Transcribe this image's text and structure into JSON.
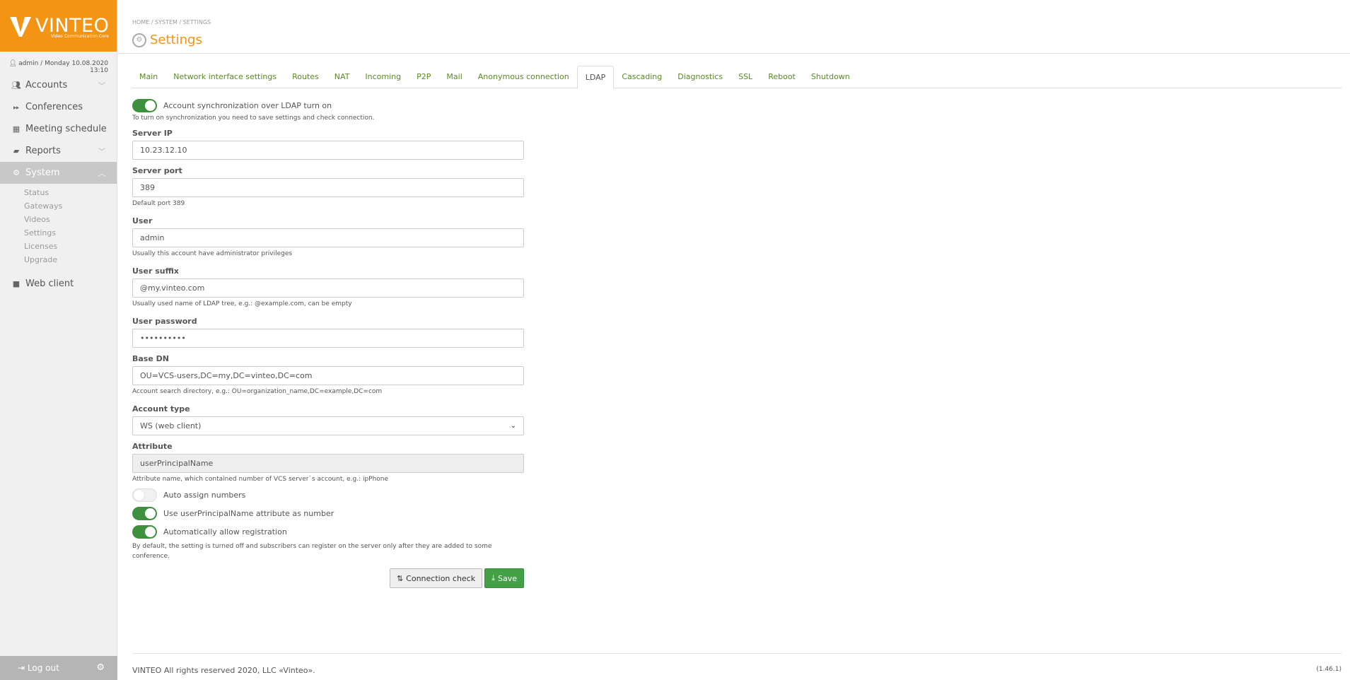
{
  "logo": {
    "title": "VINTEO",
    "subtitle": "Video Communication Core"
  },
  "user_line": "admin / Monday 10.08.2020 13:10",
  "nav": {
    "accounts": "Accounts",
    "conferences": "Conferences",
    "meeting_schedule": "Meeting schedule",
    "reports": "Reports",
    "system": "System",
    "system_sub": [
      "Status",
      "Gateways",
      "Videos",
      "Settings",
      "Licenses",
      "Upgrade"
    ],
    "web_client": "Web client",
    "logout": "Log out"
  },
  "breadcrumb": "HOME / SYSTEM / SETTINGS",
  "page_title": "Settings",
  "tabs": [
    "Main",
    "Network interface settings",
    "Routes",
    "NAT",
    "Incoming",
    "P2P",
    "Mail",
    "Anonymous connection",
    "LDAP",
    "Cascading",
    "Diagnostics",
    "SSL",
    "Reboot",
    "Shutdown"
  ],
  "active_tab": "LDAP",
  "form": {
    "sync_toggle_label": "Account synchronization over LDAP turn on",
    "sync_hint": "To turn on synchronization you need to save settings and check connection.",
    "server_ip_label": "Server IP",
    "server_ip_value": "10.23.12.10",
    "server_port_label": "Server port",
    "server_port_value": "389",
    "server_port_hint": "Default port 389",
    "user_label": "User",
    "user_value": "admin",
    "user_hint": "Usually this account have administrator privileges",
    "user_suffix_label": "User suffix",
    "user_suffix_value": "@my.vinteo.com",
    "user_suffix_hint": "Usually used name of LDAP tree, e.g.: @example.com, can be empty",
    "password_label": "User password",
    "password_value": "••••••••••",
    "base_dn_label": "Base DN",
    "base_dn_value": "OU=VCS-users,DC=my,DC=vinteo,DC=com",
    "base_dn_hint": "Account search directory, e.g.: OU=organization_name,DC=example,DC=com",
    "account_type_label": "Account type",
    "account_type_value": "WS (web client)",
    "attribute_label": "Attribute",
    "attribute_value": "userPrincipalName",
    "attribute_hint": "Attribute name, which contained number of VCS server`s account, e.g.: ipPhone",
    "auto_assign_label": "Auto assign numbers",
    "use_upn_label": "Use userPrincipalName attribute as number",
    "auto_allow_label": "Automatically allow registration",
    "auto_allow_hint_1": "By default, the setting is turned off and subscribers can register on the server only after they are added to some",
    "auto_allow_hint_2": "conference.",
    "connection_check_label": "Connection check",
    "save_label": "Save"
  },
  "toggles": {
    "sync": true,
    "auto_assign": false,
    "use_upn": true,
    "auto_allow": true
  },
  "footer": {
    "text": "VINTEO   All rights reserved 2020, LLC «Vinteo».",
    "version": "(1.46.1)"
  },
  "colors": {
    "brand": "#f39415",
    "link": "#5a8a23",
    "success": "#43a047"
  }
}
